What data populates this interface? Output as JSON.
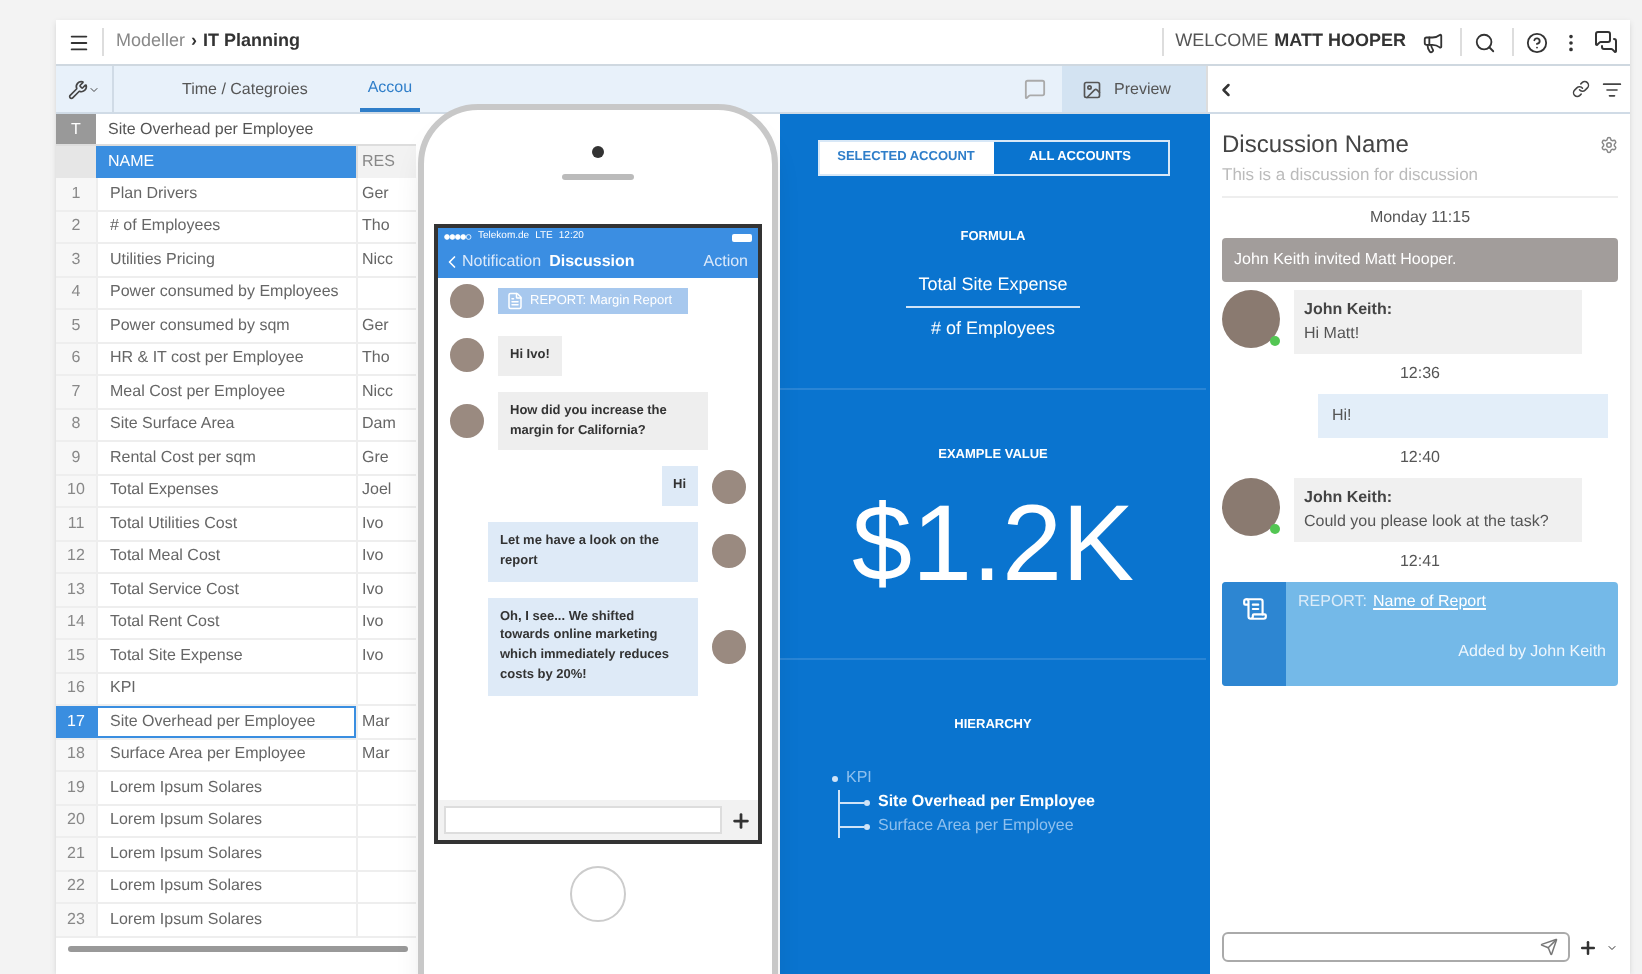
{
  "top_bar": {
    "breadcrumb": [
      "Modeller",
      "IT Planning"
    ],
    "breadcrumb_separator": "›",
    "welcome": "WELCOME",
    "user": "MATT HOOPER"
  },
  "toolbar": {
    "tabs": [
      {
        "label": "Time / Categroies",
        "selected": false
      },
      {
        "label": "Accou",
        "selected": true
      }
    ],
    "preview": "Preview"
  },
  "table": {
    "title_marker": "T",
    "title": "Site Overhead per Employee",
    "columns": [
      "NAME",
      "RES"
    ],
    "rows": [
      {
        "number": "1",
        "name": "Plan Drivers",
        "column_2": "Ger",
        "selected": false
      },
      {
        "number": "2",
        "name": "# of Employees",
        "column_2": "Tho",
        "selected": false
      },
      {
        "number": "3",
        "name": "Utilities Pricing",
        "column_2": "Nicc",
        "selected": false
      },
      {
        "number": "4",
        "name": "Power consumed by Employees",
        "selected": false
      },
      {
        "number": "5",
        "name": "Power consumed by sqm",
        "column_2": "Ger",
        "selected": false
      },
      {
        "number": "6",
        "name": "HR & IT cost per Employee",
        "column_2": "Tho",
        "selected": false
      },
      {
        "number": "7",
        "name": "Meal Cost per Employee",
        "column_2": "Nicc",
        "selected": false
      },
      {
        "number": "8",
        "name": "Site Surface Area",
        "column_2": "Dam",
        "selected": false
      },
      {
        "number": "9",
        "name": "Rental Cost per sqm",
        "column_2": "Gre",
        "selected": false
      },
      {
        "number": "10",
        "name": "Total Expenses",
        "column_2": "Joel",
        "selected": false
      },
      {
        "number": "11",
        "name": "Total Utilities Cost",
        "column_2": "Ivo",
        "selected": false
      },
      {
        "number": "12",
        "name": "Total Meal Cost",
        "column_2": "Ivo",
        "selected": false
      },
      {
        "number": "13",
        "name": "Total Service Cost",
        "column_2": "Ivo",
        "selected": false
      },
      {
        "number": "14",
        "name": "Total Rent Cost",
        "column_2": "Ivo",
        "selected": false
      },
      {
        "number": "15",
        "name": "Total Site Expense",
        "column_2": "Ivo",
        "selected": false
      },
      {
        "number": "16",
        "name": "KPI",
        "selected": false
      },
      {
        "number": "17",
        "name": "Site Overhead per Employee",
        "column_2": "Mar",
        "selected": true
      },
      {
        "number": "18",
        "name": "Surface Area per Employee",
        "column_2": "Mar",
        "selected": false
      },
      {
        "number": "19",
        "name": "Lorem Ipsum Solares",
        "selected": false
      },
      {
        "number": "20",
        "name": "Lorem Ipsum Solares",
        "selected": false
      },
      {
        "number": "21",
        "name": "Lorem Ipsum Solares",
        "selected": false
      },
      {
        "number": "22",
        "name": "Lorem Ipsum Solares",
        "selected": false
      },
      {
        "number": "23",
        "name": "Lorem Ipsum Solares",
        "selected": false
      }
    ]
  },
  "phone": {
    "carrier": "Telekom.de",
    "network": "LTE",
    "time": "12:20",
    "back": "Notification",
    "title": "Discussion",
    "action": "Action",
    "messages": [
      {
        "kind": "report",
        "text": "REPORT: Margin Report"
      },
      {
        "kind": "incoming",
        "text": "Hi Ivo!"
      },
      {
        "kind": "incoming",
        "text": "How did you increase the margin for California?"
      },
      {
        "kind": "outgoing",
        "text": "Hi"
      },
      {
        "kind": "outgoing",
        "text": "Let me have a look on the report"
      },
      {
        "kind": "outgoing",
        "text": "Oh, I see... We shifted towards online marketing which immediately reduces costs by 20%!"
      }
    ]
  },
  "preview_panel": {
    "scope_tabs": [
      {
        "label": "SELECTED ACCOUNT",
        "selected": true
      },
      {
        "label": "ALL ACCOUNTS",
        "selected": false
      }
    ],
    "formula_label": "FORMULA",
    "numerator": "Total Site Expense",
    "denominator": "# of Employees",
    "example_label": "EXAMPLE VALUE",
    "example_value": "$1.2K",
    "hierarchy_label": "HIERARCHY",
    "hierarchy": [
      {
        "label": "KPI",
        "selected": false,
        "children": [
          {
            "label": "Site Overhead per Employee",
            "selected": true
          },
          {
            "label": "Surface Area per Employee",
            "selected": false
          }
        ]
      }
    ]
  },
  "discussion": {
    "title": "Discussion Name",
    "subtitle": "This is a discussion for discussion",
    "items": [
      {
        "kind": "time",
        "text": "Monday 11:15"
      },
      {
        "kind": "notice",
        "text": "John Keith invited Matt Hooper."
      },
      {
        "kind": "incoming",
        "author": "John Keith:",
        "text": "Hi Matt!"
      },
      {
        "kind": "time",
        "text": "12:36"
      },
      {
        "kind": "outgoing",
        "text": "Hi!"
      },
      {
        "kind": "time",
        "text": "12:40"
      },
      {
        "kind": "incoming",
        "author": "John Keith:",
        "text": "Could you please look at the task?"
      },
      {
        "kind": "time",
        "text": "12:41"
      },
      {
        "kind": "report",
        "label": "REPORT:",
        "link": "Name of Report",
        "footer": "Added by John Keith"
      }
    ]
  }
}
